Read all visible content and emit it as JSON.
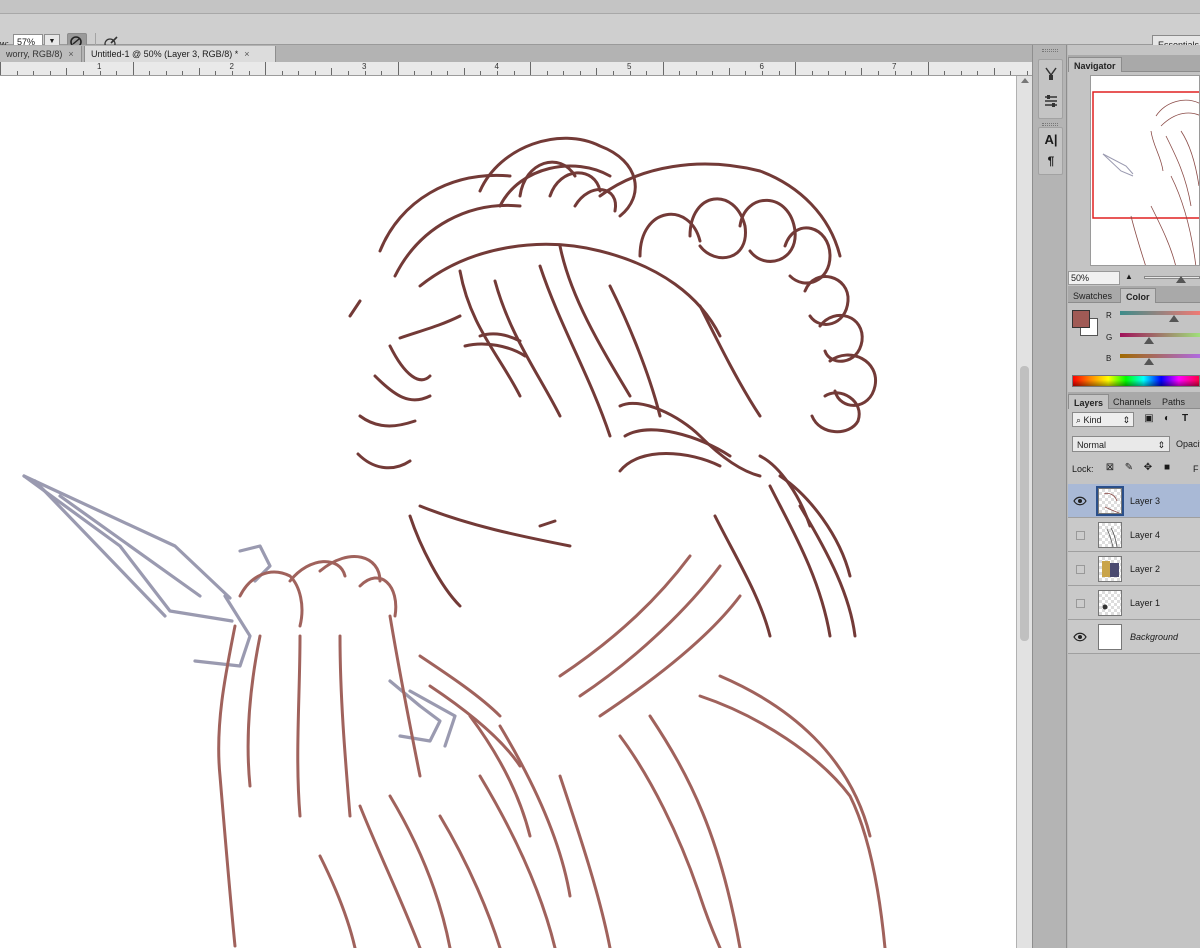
{
  "colors": {
    "sketch_brown": "#733a37",
    "sketch_rose": "#a0625c",
    "sketch_grey": "#9a9ab0",
    "fg_swatch": "#a05a55",
    "selection": "#a9b9d6"
  },
  "options_bar": {
    "zoom_label": "w:",
    "zoom_value": "57%",
    "workspace": "Essentials",
    "icons": [
      "scrubby-zoom-icon",
      "brush-icon"
    ]
  },
  "tabs": [
    {
      "label": "worry, RGB/8)",
      "close": "×"
    },
    {
      "label": "Untitled-1 @ 50% (Layer 3, RGB/8) *",
      "close": "×"
    }
  ],
  "ruler": {
    "labels": [
      "1",
      "2",
      "3",
      "4",
      "5",
      "6",
      "7"
    ]
  },
  "toolstrip": {
    "icons": [
      "history-brush-icon",
      "adjustments-icon",
      "character-icon",
      "paragraph-icon"
    ]
  },
  "navigator": {
    "tab": "Navigator",
    "zoom": "50%"
  },
  "color_panel": {
    "tabs": [
      "Swatches",
      "Color"
    ],
    "active_tab": "Color",
    "channels": [
      {
        "label": "R",
        "level": 0.68
      },
      {
        "label": "G",
        "level": 0.36
      },
      {
        "label": "B",
        "level": 0.36
      }
    ]
  },
  "layers_panel": {
    "tabs": [
      "Layers",
      "Channels",
      "Paths"
    ],
    "kind": "Kind",
    "blend_mode": "Normal",
    "opacity_label": "Opacity",
    "lock_label": "Lock:",
    "fill_label": "F",
    "layers": [
      {
        "name": "Layer 3",
        "visible": true,
        "selected": true
      },
      {
        "name": "Layer 4",
        "visible": false,
        "selected": false
      },
      {
        "name": "Layer 2",
        "visible": false,
        "selected": false
      },
      {
        "name": "Layer 1",
        "visible": false,
        "selected": false
      },
      {
        "name": "Background",
        "visible": true,
        "selected": false
      }
    ]
  }
}
